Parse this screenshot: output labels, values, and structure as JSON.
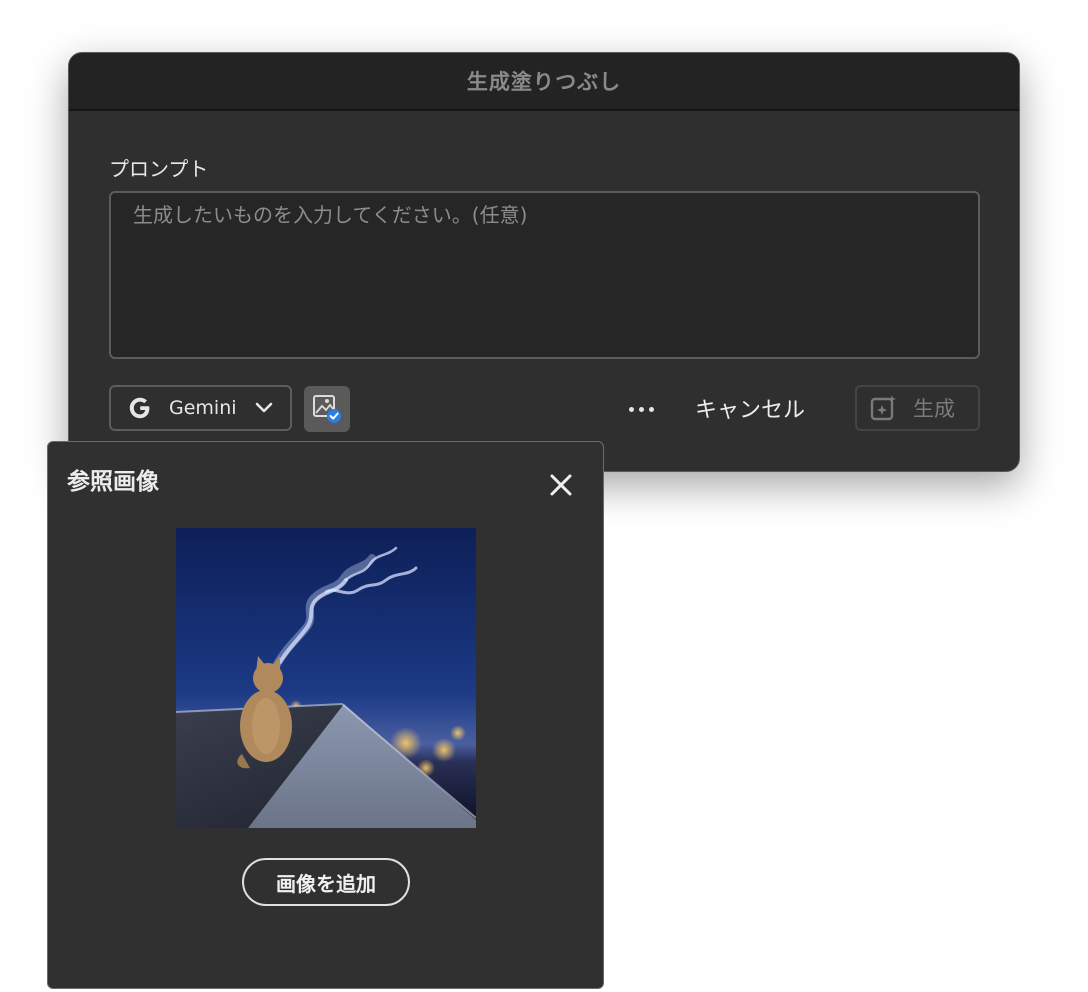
{
  "dialog": {
    "title": "生成塗りつぶし",
    "prompt_label": "プロンプト",
    "prompt_placeholder": "生成したいものを入力してください。(任意)",
    "model": {
      "icon": "google-g-icon",
      "label": "Gemini"
    },
    "reference_toggle_icon": "reference-image-check-icon",
    "more_icon": "more-dots-icon",
    "cancel_label": "キャンセル",
    "generate_label": "生成",
    "generate_icon": "generate-sparkle-icon"
  },
  "reference_panel": {
    "title": "参照画像",
    "close_icon": "close-icon",
    "image_alt": "cat on rooftop at night",
    "add_image_label": "画像を追加"
  },
  "colors": {
    "dialog_bg": "#2f2f2f",
    "titlebar_bg": "#232323",
    "accent_blue": "#2f7de1"
  }
}
